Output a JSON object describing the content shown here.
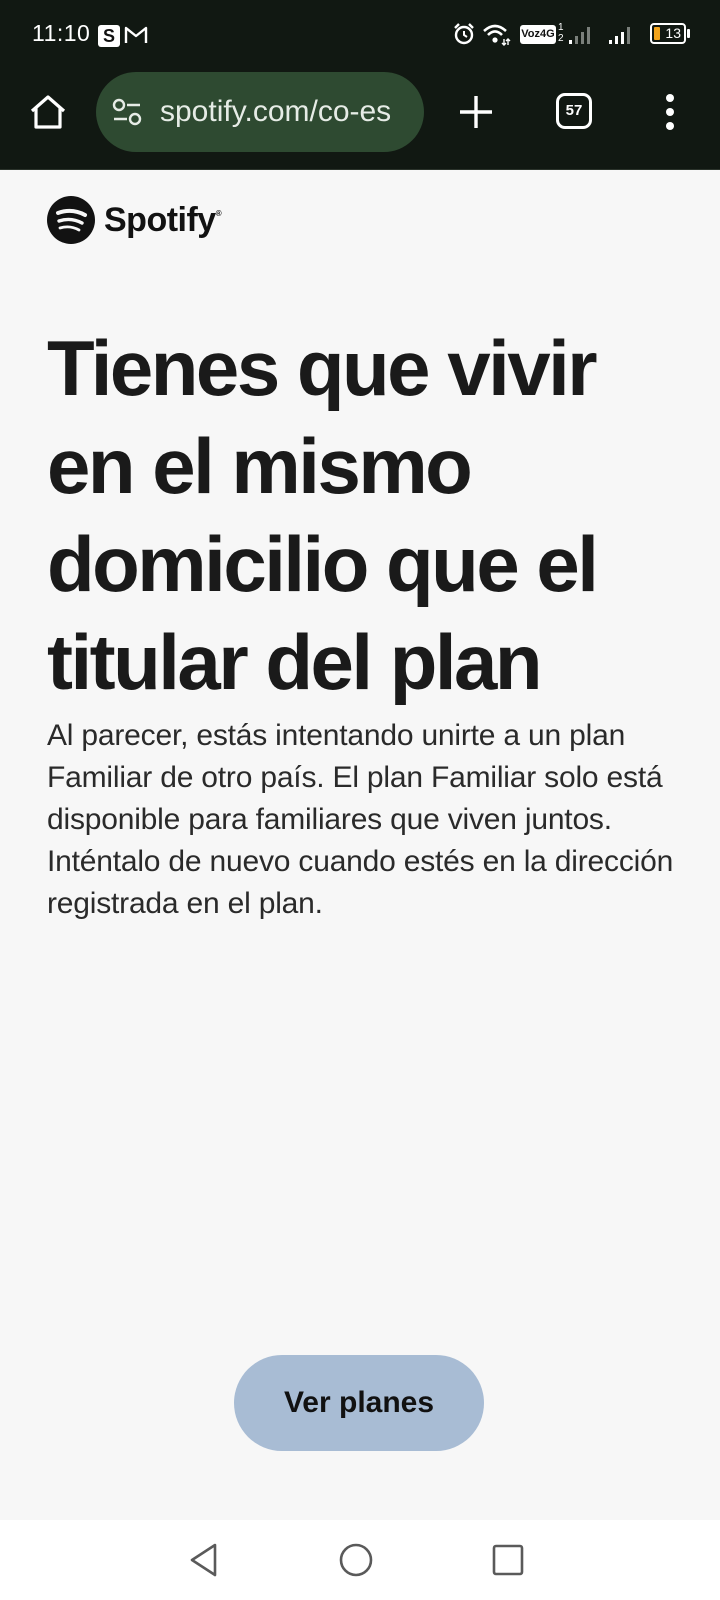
{
  "status_bar": {
    "time": "11:10",
    "s_icon": "S",
    "gmail_icon": "gmail-icon",
    "network_badge": "Voz4G",
    "network_side_top": "1",
    "network_side_bottom": "2",
    "battery": "13",
    "battery_color": "#f2a41c"
  },
  "browser": {
    "url": "spotify.com/co-es",
    "tab_count": "57",
    "url_pill_color": "#2e4a31"
  },
  "page": {
    "brand": "Spotify",
    "brand_mark": "®",
    "headline": "Tienes que vivir en el mismo domicilio que el titular del plan",
    "body": "Al parecer, estás intentando unirte a un plan Familiar de otro país. El plan Familiar solo está disponible para familiares que viven juntos. Inténtalo de nuevo cuando estés en la dirección registrada en el plan.",
    "cta_label": "Ver planes",
    "cta_color": "#a8bcd4"
  },
  "nav": {
    "icons": [
      "back-triangle-icon",
      "home-circle-icon",
      "recents-square-icon"
    ]
  }
}
